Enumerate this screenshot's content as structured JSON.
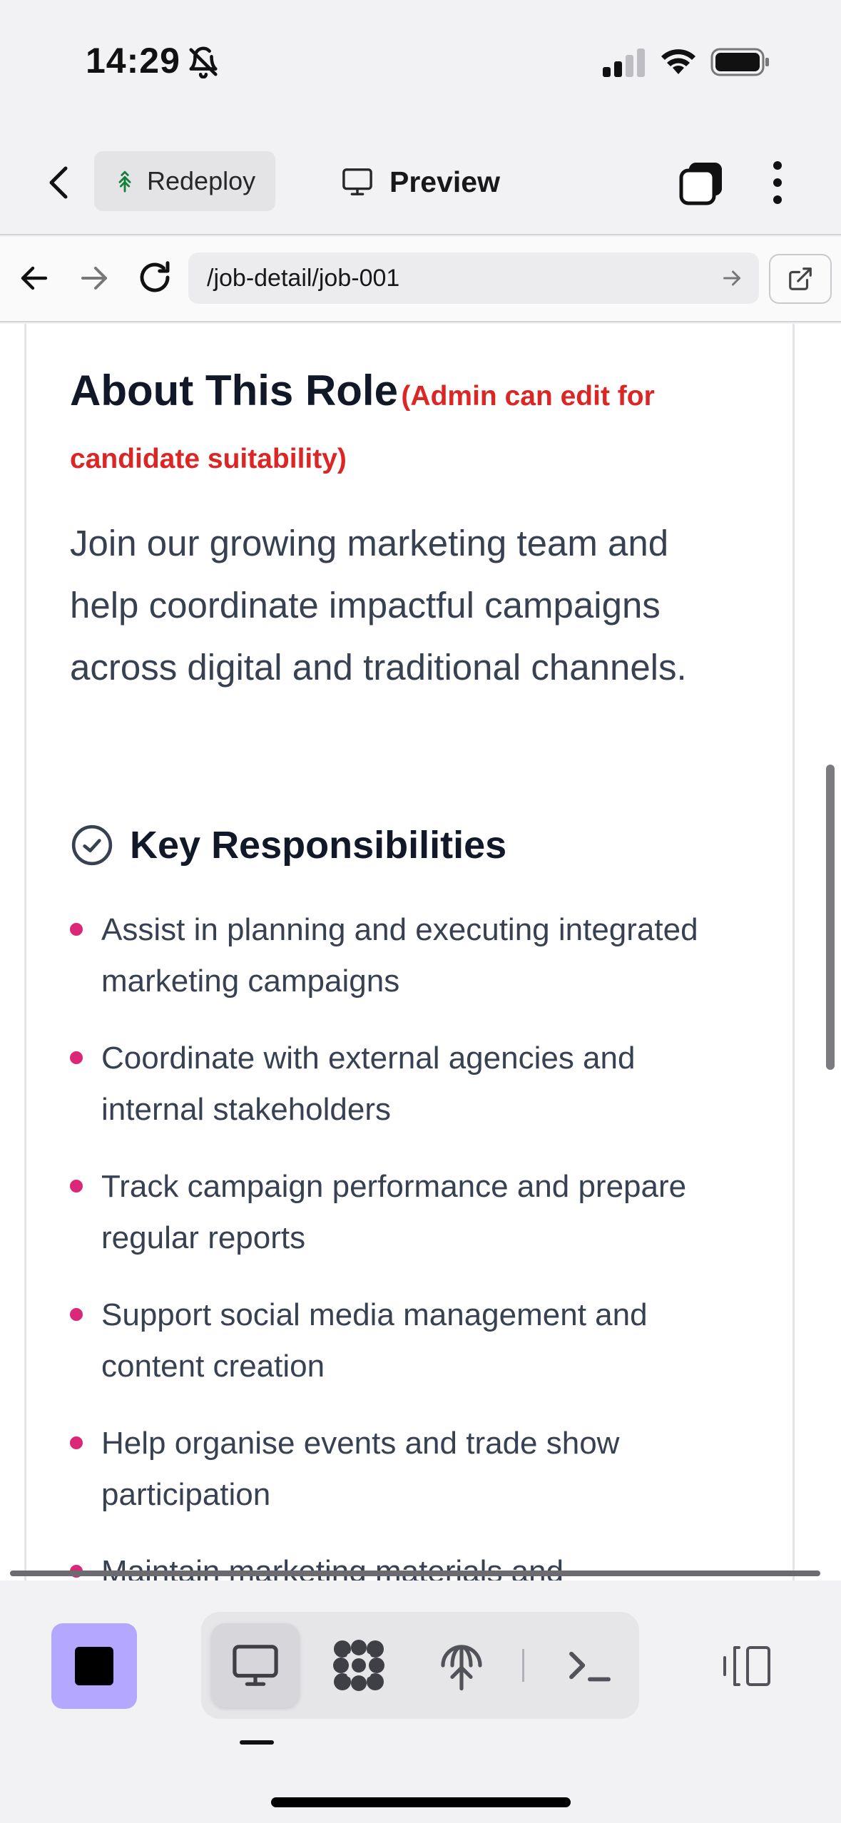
{
  "status_bar": {
    "time": "14:29"
  },
  "app_bar": {
    "redeploy_label": "Redeploy",
    "preview_label": "Preview"
  },
  "browser": {
    "url": "/job-detail/job-001"
  },
  "about_role": {
    "title": "About This Role",
    "admin_note": "(Admin can edit for candidate suitability)",
    "description": "Join our growing marketing team and help coordinate impactful campaigns across digital and traditional channels."
  },
  "responsibilities": {
    "title": "Key Responsibilities",
    "items": [
      "Assist in planning and executing integrated marketing campaigns",
      "Coordinate with external agencies and internal stakeholders",
      "Track campaign performance and prepare regular reports",
      "Support social media management and content creation",
      "Help organise events and trade show participation",
      "Maintain marketing materials and"
    ]
  },
  "colors": {
    "admin_note": "#dc2626",
    "bullet": "#db2777",
    "stop_button": "#b4a7ff"
  },
  "icons": [
    "bell-off-icon",
    "signal-icon",
    "wifi-icon",
    "battery-icon",
    "back-chevron-icon",
    "tree-icon",
    "monitor-icon",
    "tabs-icon",
    "more-vertical-icon",
    "arrow-left-icon",
    "arrow-right-icon",
    "reload-icon",
    "external-link-icon",
    "check-circle-icon",
    "stop-icon",
    "desktop-icon",
    "apps-icon",
    "deploy-icon",
    "terminal-icon",
    "split-view-icon"
  ]
}
